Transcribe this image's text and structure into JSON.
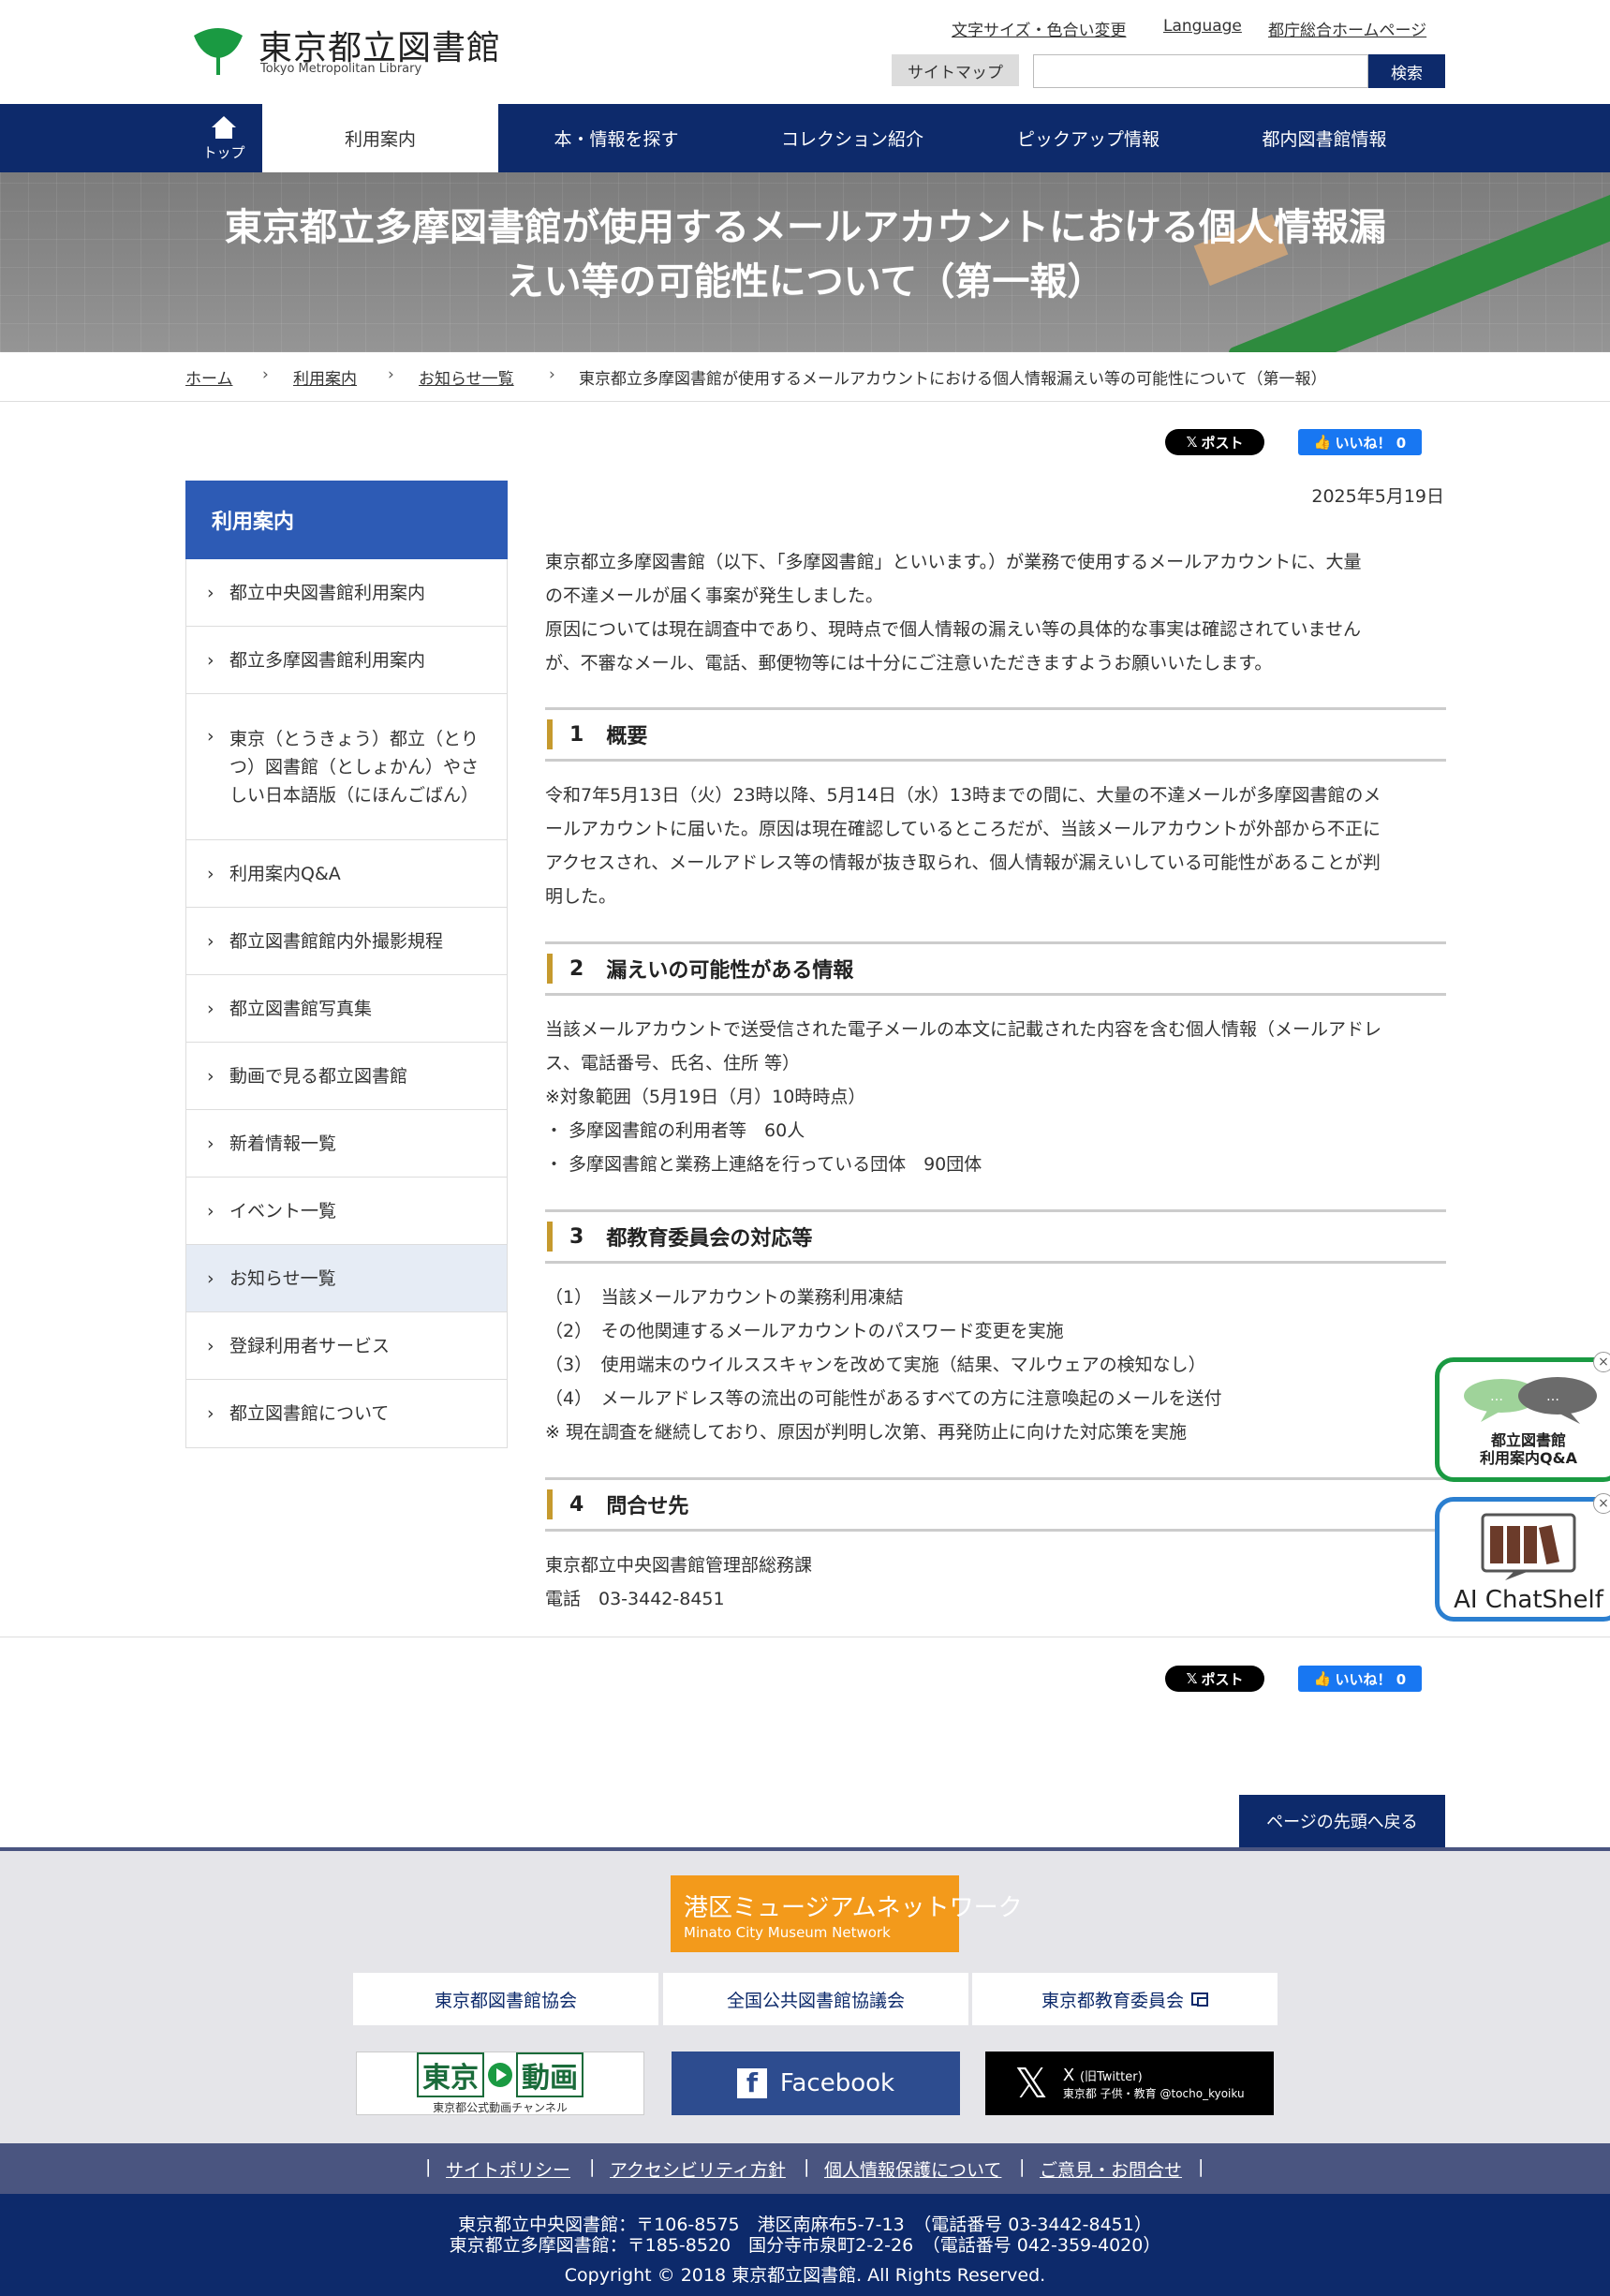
{
  "header": {
    "logo_ja": "東京都立図書館",
    "logo_en": "Tokyo Metropolitan Library",
    "util_links": [
      "文字サイズ・色合い変更",
      "Language",
      "都庁総合ホームページ"
    ],
    "sitemap": "サイトマップ",
    "search_value": "",
    "search_button": "検索"
  },
  "nav": {
    "home": "トップ",
    "items": [
      "利用案内",
      "本・情報を探す",
      "コレクション紹介",
      "ピックアップ情報",
      "都内図書館情報"
    ]
  },
  "hero": {
    "title_line1": "東京都立多摩図書館が使用するメールアカウントにおける個人情報漏",
    "title_line2": "えい等の可能性について（第一報）"
  },
  "breadcrumb": [
    "ホーム",
    "利用案内",
    "お知らせ一覧",
    "東京都立多摩図書館が使用するメールアカウントにおける個人情報漏えい等の可能性について（第一報）"
  ],
  "share": {
    "x_label": "ポスト",
    "fb_label": "いいね！ 0"
  },
  "sidebar": {
    "title": "利用案内",
    "items": [
      "都立中央図書館利用案内",
      "都立多摩図書館利用案内",
      "東京（とうきょう）都立（とりつ）図書館（としょかん）やさしい日本語版（にほんごばん）",
      "利用案内Q&A",
      "都立図書館館内外撮影規程",
      "都立図書館写真集",
      "動画で見る都立図書館",
      "新着情報一覧",
      "イベント一覧",
      "お知らせ一覧",
      "登録利用者サービス",
      "都立図書館について"
    ]
  },
  "article": {
    "date": "2025年5月19日",
    "intro": [
      "東京都立多摩図書館（以下、「多摩図書館」といいます。）が業務で使用するメールアカウントに、大量",
      "の不達メールが届く事案が発生しました。",
      "原因については現在調査中であり、現時点で個人情報の漏えい等の具体的な事実は確認されていません",
      "が、不審なメール、電話、郵便物等には十分にご注意いただきますようお願いいたします。"
    ],
    "sections": [
      {
        "num": "1",
        "title": "概要",
        "lines": [
          "令和7年5月13日（火）23時以降、5月14日（水）13時までの間に、大量の不達メールが多摩図書館のメ",
          "ールアカウントに届いた。原因は現在確認しているところだが、当該メールアカウントが外部から不正に",
          "アクセスされ、メールアドレス等の情報が抜き取られ、個人情報が漏えいしている可能性があることが判",
          "明した。"
        ]
      },
      {
        "num": "2",
        "title": "漏えいの可能性がある情報",
        "lines": [
          "当該メールアカウントで送受信された電子メールの本文に記載された内容を含む個人情報（メールアドレ",
          "ス、電話番号、氏名、住所 等）",
          "※対象範囲（5月19日（月）10時時点）",
          "・ 多摩図書館の利用者等　60人",
          "・ 多摩図書館と業務上連絡を行っている団体　90団体"
        ]
      },
      {
        "num": "3",
        "title": "都教育委員会の対応等",
        "lines": [
          "（1）　当該メールアカウントの業務利用凍結",
          "（2）　その他関連するメールアカウントのパスワード変更を実施",
          "（3）　使用端末のウイルススキャンを改めて実施（結果、マルウェアの検知なし）",
          "（4）　メールアドレス等の流出の可能性があるすべての方に注意喚起のメールを送付",
          "※ 現在調査を継続しており、原因が判明し次第、再発防止に向けた対応策を実施"
        ]
      },
      {
        "num": "4",
        "title": "問合せ先",
        "lines": [
          "東京都立中央図書館管理部総務課",
          "電話　03-3442-8451"
        ]
      }
    ]
  },
  "widgets": {
    "qa_label_1": "都立図書館",
    "qa_label_2": "利用案内Q&A",
    "chatshelf_label": "AI ChatShelf"
  },
  "page_top": "ページの先頭へ戻る",
  "footer": {
    "museum_ja": "港区ミュージアムネットワーク",
    "museum_en": "Minato City Museum Network",
    "links_boxes": [
      "東京都図書館協会",
      "全国公共図書館協議会",
      "東京都教育委員会"
    ],
    "tokyo_douga_1": "東京",
    "tokyo_douga_2": "動画",
    "tokyo_douga_sub": "東京都公式動画チャンネル",
    "facebook": "Facebook",
    "x_title": "X",
    "x_old": "(旧Twitter)",
    "x_sub": "東京都 子供・教育 @tocho_kyoiku",
    "bottom_links": [
      "サイトポリシー",
      "アクセシビリティ方針",
      "個人情報保護について",
      "ご意見・お問合せ"
    ],
    "address_1": "東京都立中央図書館：〒106-8575　港区南麻布5-7-13　（電話番号 03-3442-8451）",
    "address_2": "東京都立多摩図書館：〒185-8520　国分寺市泉町2-2-26　（電話番号 042-359-4020）",
    "copyright": "Copyright © 2018 東京都立図書館. All Rights Reserved."
  },
  "colors": {
    "navy": "#0d2a6b",
    "side_head": "#2d5bb5",
    "accent_bar": "#c69a2e",
    "logo_green": "#1a9a42"
  }
}
